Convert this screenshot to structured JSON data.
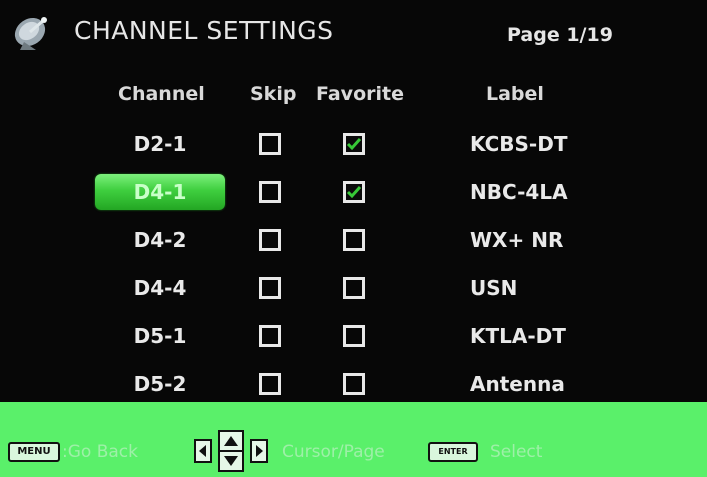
{
  "header": {
    "title": "CHANNEL SETTINGS",
    "page": "Page 1/19",
    "icon": "satellite-dish-icon"
  },
  "columns": {
    "channel": "Channel",
    "skip": "Skip",
    "favorite": "Favorite",
    "label": "Label"
  },
  "rows": [
    {
      "channel": "D2-1",
      "skip": false,
      "favorite": true,
      "label": "KCBS-DT",
      "selected": false
    },
    {
      "channel": "D4-1",
      "skip": false,
      "favorite": true,
      "label": "NBC-4LA",
      "selected": true
    },
    {
      "channel": "D4-2",
      "skip": false,
      "favorite": false,
      "label": "WX+ NR",
      "selected": false
    },
    {
      "channel": "D4-4",
      "skip": false,
      "favorite": false,
      "label": "USN",
      "selected": false
    },
    {
      "channel": "D5-1",
      "skip": false,
      "favorite": false,
      "label": "KTLA-DT",
      "selected": false
    },
    {
      "channel": "D5-2",
      "skip": false,
      "favorite": false,
      "label": "Antenna",
      "selected": false
    }
  ],
  "footer": {
    "menu_key": "MENU",
    "menu_hint": ":Go Back",
    "cursor_hint": "Cursor/Page",
    "enter_key": "ENTER",
    "enter_hint": "Select"
  },
  "colors": {
    "background": "#070707",
    "highlight": "#3fcf3f",
    "footer": "#5af06a",
    "check": "#37c837"
  }
}
